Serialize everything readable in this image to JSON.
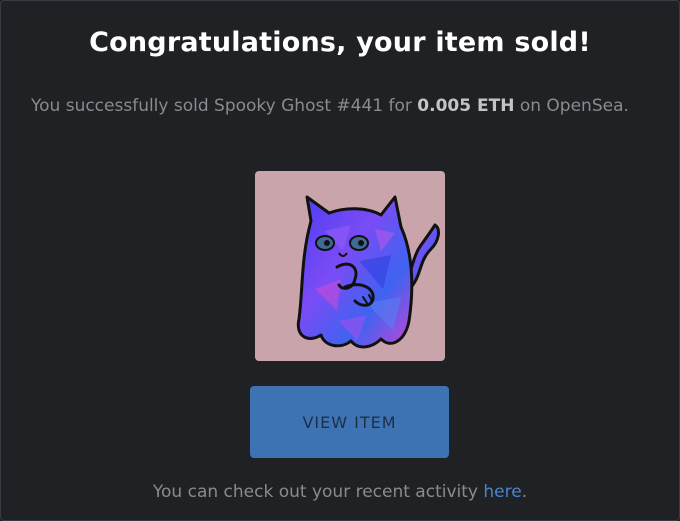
{
  "dialog": {
    "title": "Congratulations, your item sold!",
    "message_prefix": "You successfully sold Spooky Ghost #441 for",
    "amount": "0.005 ETH",
    "message_suffix": "on OpenSea.",
    "image_alt": "Spooky Ghost #441",
    "view_button_label": "VIEW ITEM",
    "footer_prefix": "You can check out your recent activity",
    "footer_link_label": "here",
    "footer_suffix": "."
  },
  "colors": {
    "background": "#202125",
    "title": "#ffffff",
    "body_text": "#8a8b8f",
    "button": "#3d73b3",
    "link": "#4a84cc",
    "nft_background": "#c9a5ab"
  }
}
